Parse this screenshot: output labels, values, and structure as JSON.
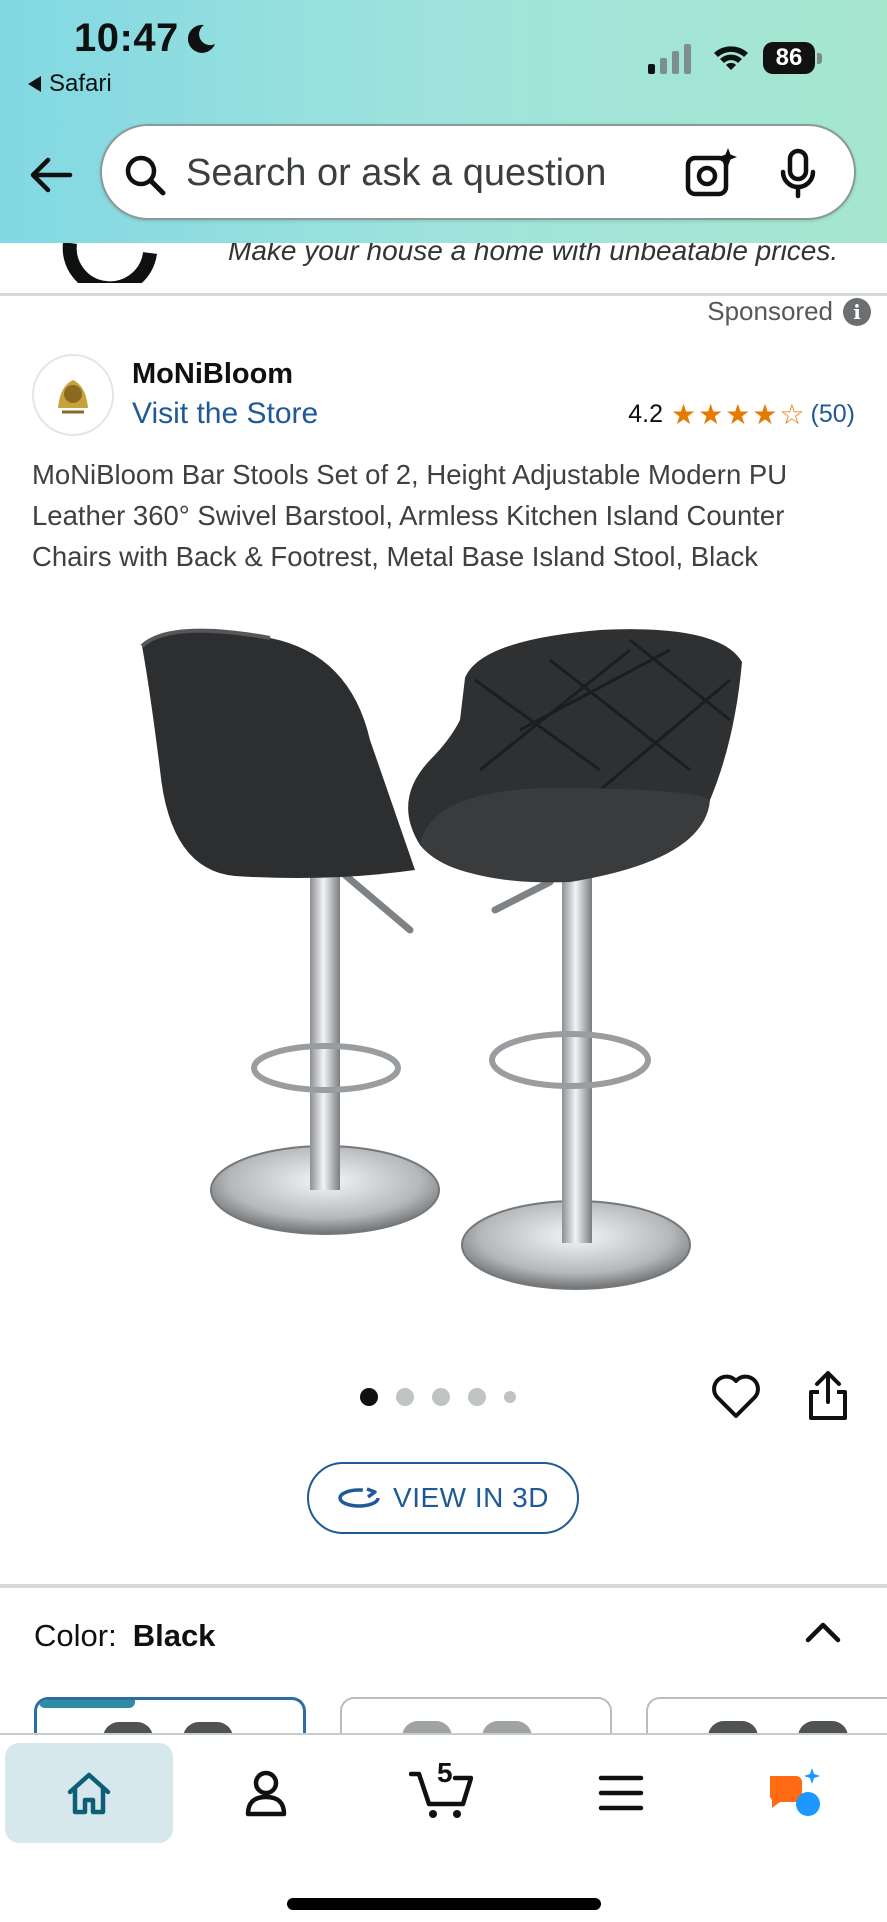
{
  "status_bar": {
    "time": "10:47",
    "back_app": "Safari",
    "battery": "86",
    "icons": [
      "moon-icon",
      "cellular-signal-icon",
      "wifi-icon",
      "battery-icon"
    ]
  },
  "search": {
    "placeholder": "Search or ask a question",
    "icons": [
      "back-arrow-icon",
      "search-icon",
      "camera-icon",
      "mic-icon"
    ]
  },
  "banner": {
    "text_fragment": "Make your house a home with unbeatable prices."
  },
  "sponsored_label": "Sponsored",
  "brand": {
    "name": "MoNiBloom",
    "visit_store": "Visit the Store"
  },
  "rating": {
    "value": "4.2",
    "stars_out_of_5": 4.2,
    "count": "(50)",
    "star_color": "#e67a00"
  },
  "product": {
    "title": "MoNiBloom Bar Stools Set of 2, Height Adjustable Modern PU Leather 360° Swivel Barstool, Armless Kitchen Island Counter Chairs with Back & Footrest, Metal Base Island Stool, Black"
  },
  "carousel": {
    "total_dots": 5,
    "active_index": 0
  },
  "actions": {
    "view_3d": "VIEW IN 3D",
    "icons": [
      "heart-icon",
      "share-icon",
      "rotate-3d-icon"
    ]
  },
  "variation": {
    "label": "Color:",
    "selected": "Black"
  },
  "tabbar": {
    "cart_count": "5",
    "tabs": [
      "home-icon",
      "account-icon",
      "cart-icon",
      "menu-icon",
      "rufus-icon"
    ],
    "active_tab": "home"
  },
  "colors": {
    "header_gradient_start": "#82d8e3",
    "header_gradient_end": "#a6e6cf",
    "link_blue": "#1f5a96",
    "active_tab_bg": "#d6e8ec",
    "rufus_orange": "#ff6a13",
    "rufus_blue": "#1a98ff"
  }
}
